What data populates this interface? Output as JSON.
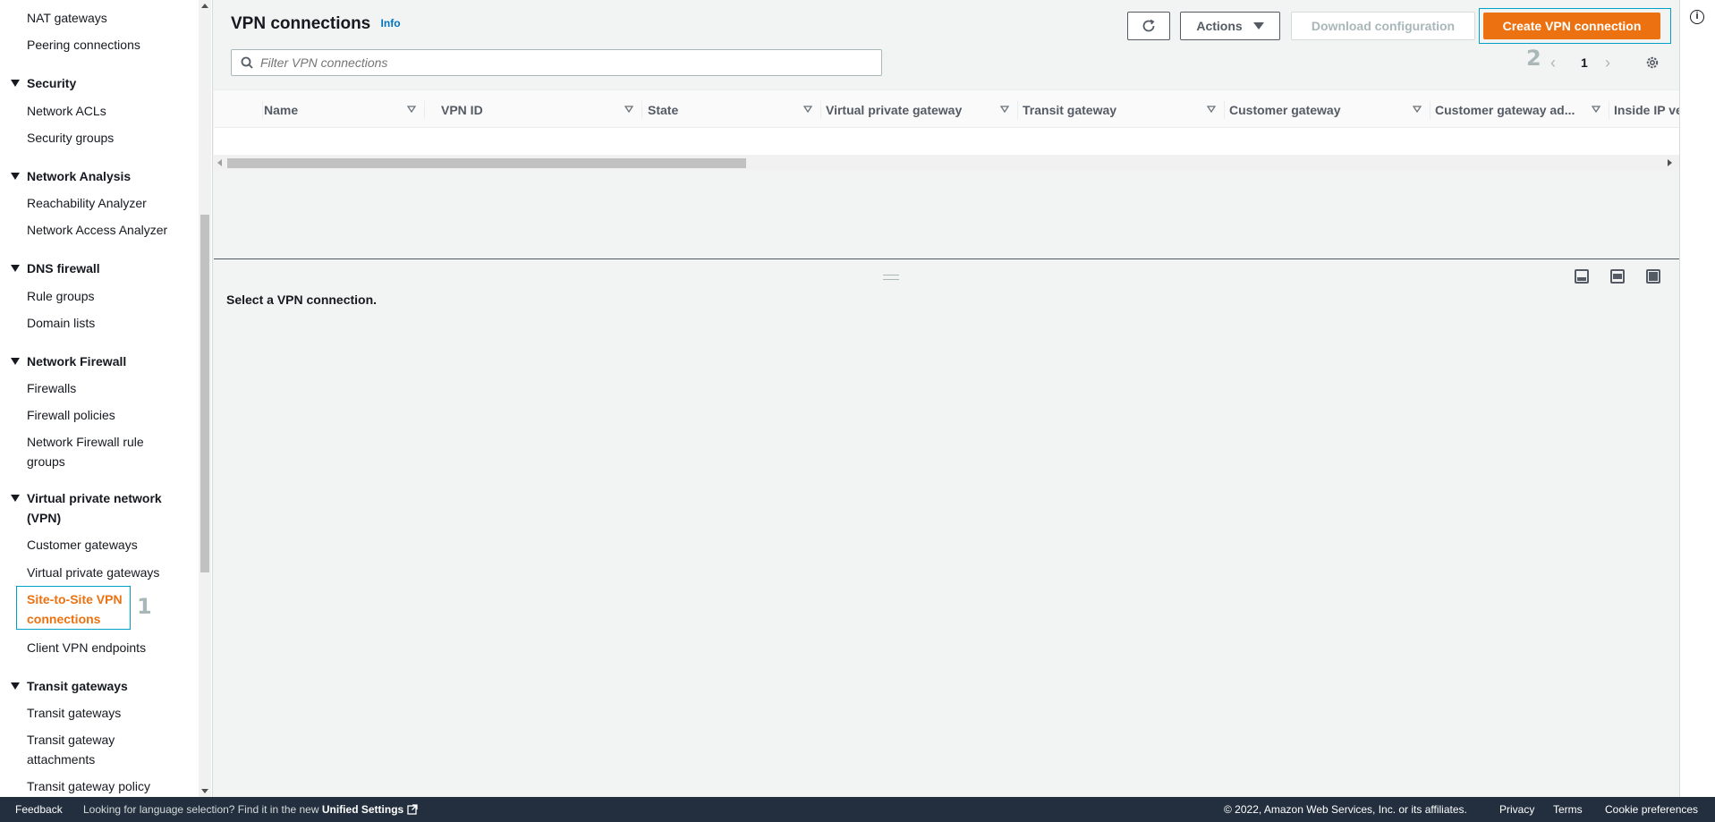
{
  "sidebar": {
    "items": [
      {
        "type": "item",
        "label": "NAT gateways"
      },
      {
        "type": "item",
        "label": "Peering connections"
      },
      {
        "type": "section",
        "label": "Security"
      },
      {
        "type": "item",
        "label": "Network ACLs"
      },
      {
        "type": "item",
        "label": "Security groups"
      },
      {
        "type": "section",
        "label": "Network Analysis"
      },
      {
        "type": "item",
        "label": "Reachability Analyzer"
      },
      {
        "type": "item",
        "label": "Network Access Analyzer"
      },
      {
        "type": "section",
        "label": "DNS firewall"
      },
      {
        "type": "item",
        "label": "Rule groups"
      },
      {
        "type": "item",
        "label": "Domain lists"
      },
      {
        "type": "section",
        "label": "Network Firewall"
      },
      {
        "type": "item",
        "label": "Firewalls"
      },
      {
        "type": "item",
        "label": "Firewall policies"
      },
      {
        "type": "item",
        "label": "Network Firewall rule groups"
      },
      {
        "type": "section",
        "label": "Virtual private network (VPN)"
      },
      {
        "type": "item",
        "label": "Customer gateways"
      },
      {
        "type": "item",
        "label": "Virtual private gateways"
      },
      {
        "type": "item",
        "label": "Site-to-Site VPN connections",
        "active": true
      },
      {
        "type": "item",
        "label": "Client VPN endpoints"
      },
      {
        "type": "section",
        "label": "Transit gateways"
      },
      {
        "type": "item",
        "label": "Transit gateways"
      },
      {
        "type": "item",
        "label": "Transit gateway attachments"
      },
      {
        "type": "item",
        "label": "Transit gateway policy"
      }
    ],
    "step_marker": "1"
  },
  "header": {
    "title": "VPN connections",
    "info_link": "Info",
    "refresh_icon": "refresh-icon",
    "actions_label": "Actions",
    "download_label": "Download configuration",
    "create_label": "Create VPN connection",
    "step_marker": "2"
  },
  "search": {
    "placeholder": "Filter VPN connections"
  },
  "pagination": {
    "page": "1"
  },
  "table": {
    "columns": [
      "Name",
      "VPN ID",
      "State",
      "Virtual private gateway",
      "Transit gateway",
      "Customer gateway",
      "Customer gateway ad...",
      "Inside IP ve"
    ]
  },
  "split_panel": {
    "message": "Select a VPN connection."
  },
  "footer": {
    "feedback": "Feedback",
    "lang_prefix": "Looking for language selection? Find it in the new",
    "lang_link": "Unified Settings",
    "copyright": "© 2022, Amazon Web Services, Inc. or its affiliates.",
    "privacy": "Privacy",
    "terms": "Terms",
    "cookies": "Cookie preferences"
  },
  "colors": {
    "accent": "#ec7211",
    "highlight": "#00a1c9",
    "footer_bg": "#232f3e"
  }
}
